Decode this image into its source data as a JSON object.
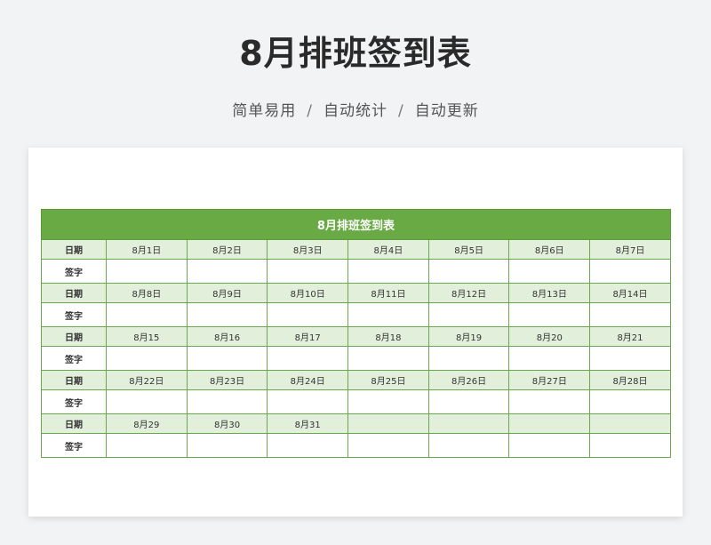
{
  "header": {
    "title": "8月排班签到表",
    "features": [
      "简单易用",
      "自动统计",
      "自动更新"
    ],
    "separator": "/"
  },
  "sheet": {
    "table_title": "8月排班签到表",
    "date_label": "日期",
    "sign_label": "签字",
    "weeks": [
      [
        "8月1日",
        "8月2日",
        "8月3日",
        "8月4日",
        "8月5日",
        "8月6日",
        "8月7日"
      ],
      [
        "8月8日",
        "8月9日",
        "8月10日",
        "8月11日",
        "8月12日",
        "8月13日",
        "8月14日"
      ],
      [
        "8月15",
        "8月16",
        "8月17",
        "8月18",
        "8月19",
        "8月20",
        "8月21"
      ],
      [
        "8月22日",
        "8月23日",
        "8月24日",
        "8月25日",
        "8月26日",
        "8月27日",
        "8月28日"
      ],
      [
        "8月29",
        "8月30",
        "8月31",
        "",
        "",
        "",
        ""
      ]
    ]
  },
  "colors": {
    "title_bar": "#6aaa45",
    "date_row": "#e2efda",
    "border": "#6aa84f"
  }
}
